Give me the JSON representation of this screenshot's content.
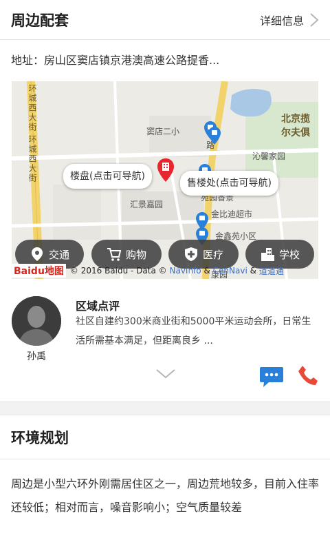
{
  "header": {
    "title": "周边配套",
    "detail_label": "详细信息"
  },
  "address": "地址：房山区窦店镇京港澳高速公路提香...",
  "map": {
    "road_labels": [
      "环城西大街",
      "环城西大街"
    ],
    "places": [
      "窦店二小",
      "沁馨家园",
      "汇景嘉园",
      "金比迪超市",
      "金鑫苑小区",
      "北京揽",
      "尔夫俱",
      "路",
      "苑园香景",
      "康园"
    ],
    "callouts": {
      "project": "楼盘(点击可导航)",
      "sales": "售楼处(点击可导航)"
    },
    "buttons": [
      "交通",
      "购物",
      "医疗",
      "学校"
    ],
    "copyright": {
      "logo": "Baidu地图",
      "text": "© 2016 Baidu - Data ©",
      "link1": "NavInfo",
      "amp1": "&",
      "link2": "CenNavi",
      "amp2": "&",
      "link3": "道道通"
    }
  },
  "review": {
    "reviewer": "孙禹",
    "title": "区域点评",
    "text": "社区自建约300米商业街和5000平米运动会所，日常生活所需基本满足，但距离良乡 ..."
  },
  "environment": {
    "title": "环境规划",
    "text": "周边是小型六环外刚需居住区之一，周边荒地较多，目前入住率还较低；相对而言，噪音影响小；空气质量较差"
  },
  "colors": {
    "accent_blue": "#2a7fd9",
    "call_red": "#e84a3a",
    "pin_red": "#e8262d"
  }
}
